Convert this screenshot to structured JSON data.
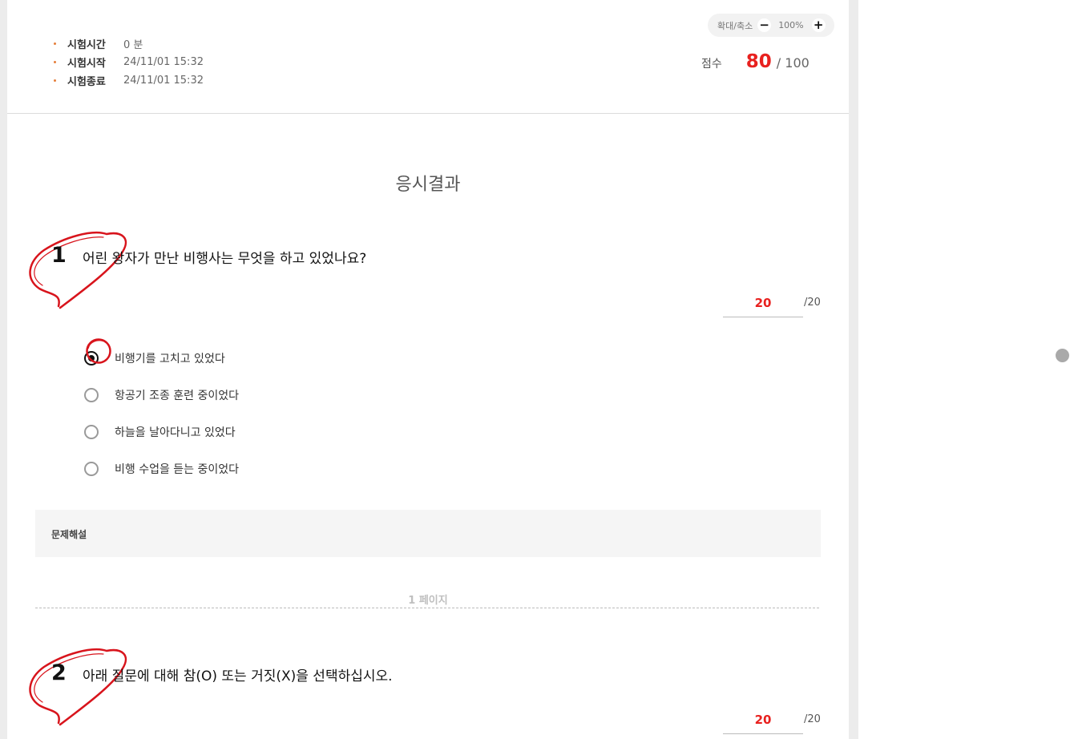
{
  "header": {
    "info": [
      {
        "label": "시험시간",
        "value": "0 분"
      },
      {
        "label": "시험시작",
        "value": "24/11/01 15:32"
      },
      {
        "label": "시험종료",
        "value": "24/11/01 15:32"
      }
    ],
    "zoom": {
      "label": "확대/축소",
      "minus": "−",
      "percent": "100%",
      "plus": "+"
    },
    "score": {
      "label": "점수",
      "value": "80",
      "total": "/ 100"
    }
  },
  "page_title": "응시결과",
  "questions": [
    {
      "number": "1",
      "text": "어린 왕자가 만난 비행사는 무엇을 하고 있었나요?",
      "points": "20",
      "max_points": "/20",
      "options": [
        {
          "label": "비행기를 고치고 있었다",
          "selected": true
        },
        {
          "label": "항공기 조종 훈련 중이었다",
          "selected": false
        },
        {
          "label": "하늘을 날아다니고 있었다",
          "selected": false
        },
        {
          "label": "비행 수업을 듣는 중이었다",
          "selected": false
        }
      ],
      "explanation_label": "문제해설"
    },
    {
      "number": "2",
      "text": "아래 질문에 대해 참(O) 또는 거짓(X)을 선택하십시오.",
      "points": "20",
      "max_points": "/20"
    }
  ],
  "page_label": "1 페이지",
  "colors": {
    "accent": "#e8211f",
    "bullet": "#e57f3b",
    "mark": "#d8141c"
  }
}
